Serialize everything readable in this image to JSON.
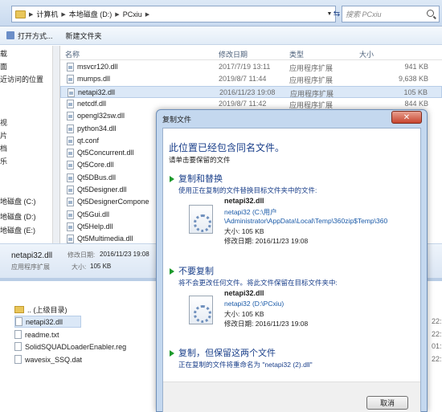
{
  "address": {
    "segments": [
      "计算机",
      "本地磁盘 (D:)",
      "PCxiu"
    ],
    "search_placeholder": "搜索 PCxiu"
  },
  "toolbar": {
    "open_label": "打开方式...",
    "new_folder_label": "新建文件夹"
  },
  "navpane": {
    "items": [
      "载",
      "面",
      "近访问的位置",
      "",
      "",
      "视",
      "片",
      "档",
      "乐",
      "",
      "",
      "地磁盘 (C:)",
      "地磁盘 (D:)",
      "地磁盘 (E:)"
    ]
  },
  "filelist": {
    "columns": {
      "name": "名称",
      "date": "修改日期",
      "type": "类型",
      "size": "大小"
    },
    "rows": [
      {
        "name": "msvcr120.dll",
        "date": "2017/7/19 13:11",
        "type": "应用程序扩展",
        "size": "941 KB"
      },
      {
        "name": "mumps.dll",
        "date": "2019/8/7 11:44",
        "type": "应用程序扩展",
        "size": "9,638 KB"
      },
      {
        "name": "netapi32.dll",
        "date": "2016/11/23 19:08",
        "type": "应用程序扩展",
        "size": "105 KB"
      },
      {
        "name": "netcdf.dll",
        "date": "2019/8/7 11:42",
        "type": "应用程序扩展",
        "size": "844 KB"
      },
      {
        "name": "opengl32sw.dll",
        "date": "",
        "type": "",
        "size": ""
      },
      {
        "name": "python34.dll",
        "date": "",
        "type": "",
        "size": ""
      },
      {
        "name": "qt.conf",
        "date": "",
        "type": "",
        "size": ""
      },
      {
        "name": "Qt5Concurrent.dll",
        "date": "",
        "type": "",
        "size": ""
      },
      {
        "name": "Qt5Core.dll",
        "date": "",
        "type": "",
        "size": ""
      },
      {
        "name": "Qt5DBus.dll",
        "date": "",
        "type": "",
        "size": ""
      },
      {
        "name": "Qt5Designer.dll",
        "date": "",
        "type": "",
        "size": ""
      },
      {
        "name": "Qt5DesignerCompone",
        "date": "",
        "type": "",
        "size": ""
      },
      {
        "name": "Qt5Gui.dll",
        "date": "",
        "type": "",
        "size": ""
      },
      {
        "name": "Qt5Help.dll",
        "date": "",
        "type": "",
        "size": ""
      },
      {
        "name": "Qt5Multimedia.dll",
        "date": "",
        "type": "",
        "size": ""
      }
    ]
  },
  "details": {
    "file_name": "netapi32.dll",
    "modified_label": "修改日期:",
    "modified_value": "2016/11/23 19:08",
    "type_value": "应用程序扩展",
    "size_label": "大小:",
    "size_value": "105 KB"
  },
  "explorer2": {
    "rows": [
      {
        "name": ".. (上级目录)",
        "time": ""
      },
      {
        "name": "netapi32.dll",
        "time": "22:"
      },
      {
        "name": "readme.txt",
        "time": "22:"
      },
      {
        "name": "SolidSQUADLoaderEnabler.reg",
        "time": "01:"
      },
      {
        "name": "wavesix_SSQ.dat",
        "time": "22:"
      }
    ]
  },
  "dialog": {
    "title": "复制文件",
    "heading": "此位置已经包含同名文件。",
    "subtitle": "请单击要保留的文件",
    "option_replace": {
      "title": "复制和替换",
      "desc": "使用正在复制的文件替换目标文件夹中的文件:",
      "file_name": "netapi32.dll",
      "path1": "netapi32 (C:\\用户",
      "path2": "\\Administrator\\AppData\\Local\\Temp\\360zip$Temp\\360",
      "size": "大小: 105 KB",
      "modified": "修改日期: 2016/11/23 19:08"
    },
    "option_skip": {
      "title": "不要复制",
      "desc": "将不会更改任何文件。将此文件保留在目标文件夹中:",
      "file_name": "netapi32.dll",
      "path1": "netapi32 (D:\\PCxiu)",
      "size": "大小: 105 KB",
      "modified": "修改日期: 2016/11/23 19:08"
    },
    "option_keep_both": {
      "title": "复制，但保留这两个文件",
      "desc": "正在复制的文件将重命名为 \"netapi32 (2).dll\""
    },
    "cancel_label": "取消"
  }
}
